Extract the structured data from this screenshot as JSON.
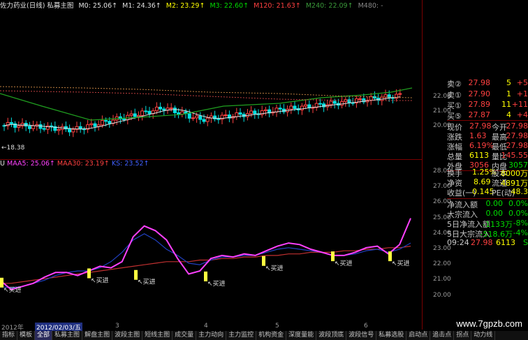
{
  "header": {
    "title": "佐力药业(日线) 私募主图",
    "m0": "M0: 25.06↑",
    "m1": "M1: 24.36↑",
    "m2": "M2: 23.29↑",
    "m3": "M3: 22.60↑",
    "m120": "M120: 21.63↑",
    "m240": "M240: 22.09↑",
    "m480": "M480: -"
  },
  "price_axis": [
    "22.00",
    "21.00",
    "20.00"
  ],
  "low_marker": "←18.38",
  "indicator_bar": {
    "name": "U",
    "maa5": "MAA5: 25.06↑",
    "maa30": "MAA30: 23.19↑",
    "ks": "KS: 23.52↑"
  },
  "indicator_axis": [
    "28.00",
    "27.00",
    "26.00",
    "25.00",
    "24.00",
    "23.00",
    "22.00",
    "21.00",
    "20.00"
  ],
  "buy_label": "买进",
  "date_bar": {
    "year": "2012年",
    "current_date": "2012/02/03/五",
    "months": [
      "3",
      "4",
      "5",
      "6"
    ]
  },
  "quote_panel": {
    "asks": [
      {
        "label": "卖②",
        "price": "27.98",
        "vol": "5",
        "chg": "+5"
      },
      {
        "label": "卖①",
        "price": "27.90",
        "vol": "1",
        "chg": "+1"
      },
      {
        "label": "买①",
        "price": "27.89",
        "vol": "11",
        "chg": "+11"
      },
      {
        "label": "买⑤",
        "price": "27.87",
        "vol": "4",
        "chg": "+4"
      }
    ],
    "stats": [
      {
        "l1": "现价",
        "v1": "27.98",
        "l2": "今开",
        "v2": "27.98"
      },
      {
        "l1": "涨跌",
        "v1": "1.63",
        "l2": "最高",
        "v2": "27.98"
      },
      {
        "l1": "涨幅",
        "v1": "6.19%",
        "l2": "最低",
        "v2": "27.98"
      },
      {
        "l1": "总量",
        "v1": "6113",
        "l2": "量比",
        "v2": "145.55"
      },
      {
        "l1": "外盘",
        "v1": "3056",
        "l2": "内盘",
        "v2": "3057"
      }
    ],
    "fund": [
      {
        "l1": "换手",
        "v1": "1.25%",
        "l2": "股本",
        "v2": "8000万"
      },
      {
        "l1": "净资",
        "v1": "8.69",
        "l2": "流通",
        "v2": "4891万"
      },
      {
        "l1": "收益(一)",
        "v1": "0.145",
        "l2": "PE(动)",
        "v2": "48.3"
      }
    ],
    "flow": [
      {
        "label": "净流入额",
        "v1": "0.00",
        "v2": "0.0%"
      },
      {
        "label": "大宗流入",
        "v1": "0.00",
        "v2": "0.0%"
      },
      {
        "label": "5日净流入额",
        "v1": "-1133万",
        "v2": "-8%"
      },
      {
        "label": "5日大宗流入",
        "v1": "-518.6万",
        "v2": "-4%"
      }
    ],
    "tick": {
      "time": "09:24",
      "price": "27.98",
      "vol": "6113",
      "side": "S"
    }
  },
  "tabs": [
    "指标",
    "模板",
    "全部",
    "私募主图",
    "解盘主图",
    "波段主图",
    "短线主图",
    "成交量",
    "主力动向",
    "主力监控",
    "机构资金",
    "深度量能",
    "波段顶底",
    "波段信号",
    "私募选股",
    "启动点",
    "追击点",
    "拐点",
    "动力线"
  ],
  "active_tab_index": 2,
  "watermark": "www.7gpzb.com",
  "colors": {
    "up": "#ff4040",
    "down": "#00e0e0",
    "magenta": "#ff40ff",
    "red_line": "#c03030",
    "blue_line": "#2040c0",
    "buy": "#ffff40"
  }
}
